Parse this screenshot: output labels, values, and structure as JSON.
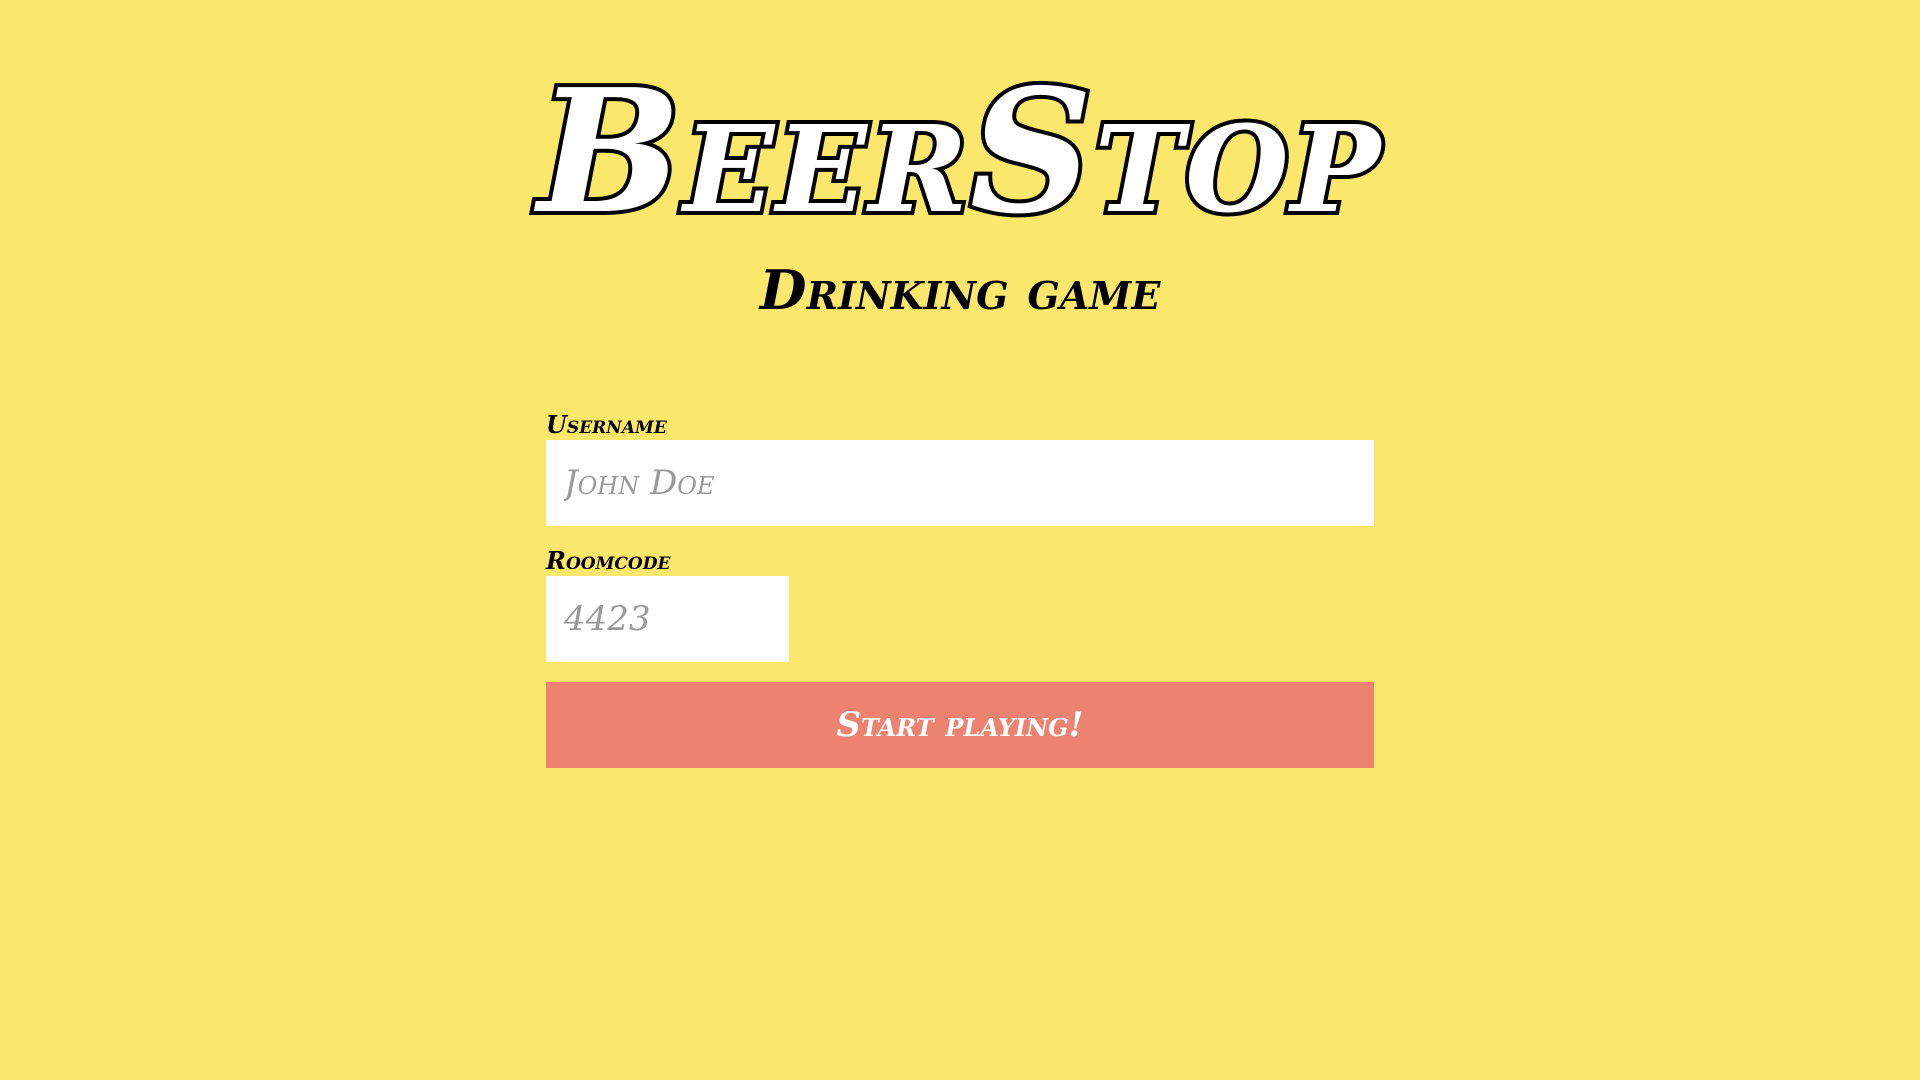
{
  "header": {
    "logo_text": "BeerStop",
    "subtitle": "Drinking game"
  },
  "form": {
    "username": {
      "label": "Username",
      "placeholder": "John Doe",
      "value": ""
    },
    "roomcode": {
      "label": "Roomcode",
      "placeholder": "4423",
      "value": ""
    },
    "submit_label": "Start playing!"
  },
  "colors": {
    "background": "#fbe76c",
    "button": "#ec8370",
    "input_background": "#ffffff",
    "placeholder": "#9a9a9a"
  }
}
